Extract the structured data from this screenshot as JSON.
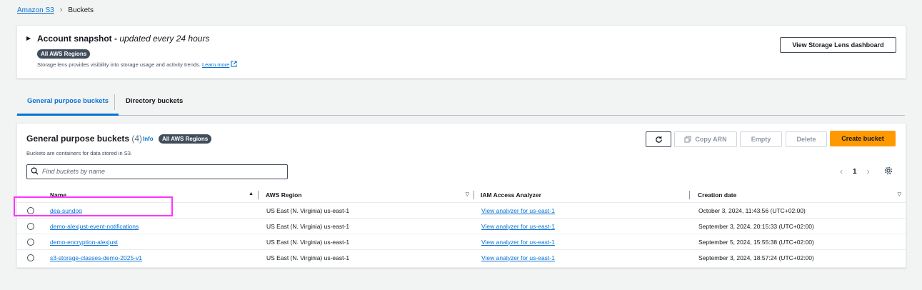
{
  "breadcrumb": {
    "root": "Amazon S3",
    "current": "Buckets"
  },
  "snapshot": {
    "title": "Account snapshot",
    "separator": "-",
    "subtitle": "updated every 24 hours",
    "badge": "All AWS Regions",
    "description": "Storage lens provides visibility into storage usage and activity trends.",
    "learn_more": "Learn more",
    "button": "View Storage Lens dashboard"
  },
  "tabs": [
    {
      "label": "General purpose buckets",
      "active": true
    },
    {
      "label": "Directory buckets",
      "active": false
    }
  ],
  "buckets_panel": {
    "title": "General purpose buckets",
    "count": "(4)",
    "info": "Info",
    "badge": "All AWS Regions",
    "description": "Buckets are containers for data stored in S3.",
    "refresh_icon": "refresh-icon",
    "copy_arn": "Copy ARN",
    "empty": "Empty",
    "delete": "Delete",
    "create": "Create bucket",
    "search_placeholder": "Find buckets by name",
    "page": "1",
    "accent": "#ff9900",
    "link_color": "#0972d3"
  },
  "columns": [
    "Name",
    "AWS Region",
    "IAM Access Analyzer",
    "Creation date"
  ],
  "rows": [
    {
      "name": "dea-sundog",
      "region": "US East (N. Virginia) us-east-1",
      "analyzer": "View analyzer for us-east-1",
      "created": "October 3, 2024, 11:43:56 (UTC+02:00)"
    },
    {
      "name": "demo-alexjust-event-notifications",
      "region": "US East (N. Virginia) us-east-1",
      "analyzer": "View analyzer for us-east-1",
      "created": "September 3, 2024, 20:15:33 (UTC+02:00)"
    },
    {
      "name": "demo-encryption-alexjust",
      "region": "US East (N. Virginia) us-east-1",
      "analyzer": "View analyzer for us-east-1",
      "created": "September 5, 2024, 15:55:38 (UTC+02:00)"
    },
    {
      "name": "s3-storage-classes-demo-2025-v1",
      "region": "US East (N. Virginia) us-east-1",
      "analyzer": "View analyzer for us-east-1",
      "created": "September 3, 2024, 18:57:24 (UTC+02:00)"
    }
  ]
}
